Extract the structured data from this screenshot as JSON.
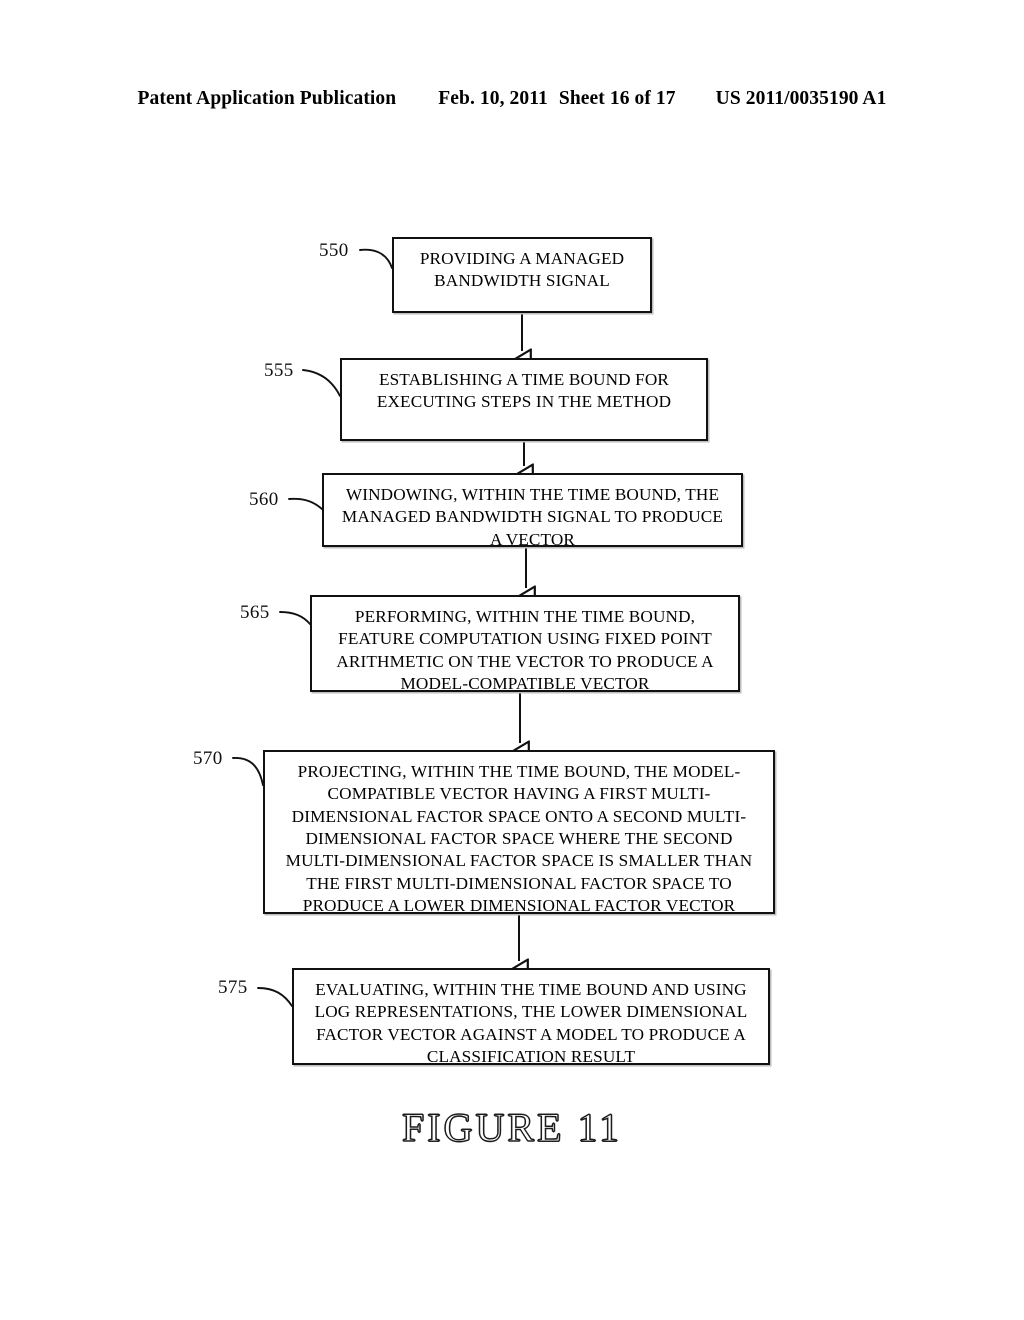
{
  "header": {
    "publication": "Patent Application Publication",
    "date": "Feb. 10, 2011",
    "sheet": "Sheet 16 of 17",
    "publication_number": "US 2011/0035190 A1"
  },
  "figure": {
    "caption": "FIGURE  11",
    "type": "flowchart",
    "orientation": "top-to-bottom",
    "arrow_style": "hollow-triangle"
  },
  "flowchart": {
    "steps": [
      {
        "ref": "550",
        "text": "PROVIDING A MANAGED\nBANDWIDTH SIGNAL"
      },
      {
        "ref": "555",
        "text": "ESTABLISHING A TIME BOUND FOR\nEXECUTING STEPS IN THE METHOD"
      },
      {
        "ref": "560",
        "text": "WINDOWING, WITHIN THE TIME BOUND, THE\nMANAGED BANDWIDTH SIGNAL TO PRODUCE\nA VECTOR"
      },
      {
        "ref": "565",
        "text": "PERFORMING, WITHIN THE TIME BOUND,\nFEATURE COMPUTATION USING FIXED POINT\nARITHMETIC ON THE VECTOR TO PRODUCE A\nMODEL-COMPATIBLE VECTOR"
      },
      {
        "ref": "570",
        "text": "PROJECTING, WITHIN THE TIME BOUND, THE MODEL-\nCOMPATIBLE VECTOR HAVING A FIRST MULTI-\nDIMENSIONAL FACTOR SPACE ONTO A SECOND MULTI-\nDIMENSIONAL FACTOR SPACE WHERE THE SECOND\nMULTI-DIMENSIONAL FACTOR SPACE IS SMALLER THAN\nTHE FIRST MULTI-DIMENSIONAL FACTOR SPACE TO\nPRODUCE A LOWER DIMENSIONAL FACTOR VECTOR"
      },
      {
        "ref": "575",
        "text": "EVALUATING, WITHIN THE TIME BOUND AND USING\nLOG REPRESENTATIONS, THE LOWER DIMENSIONAL\nFACTOR VECTOR AGAINST A MODEL TO PRODUCE A\nCLASSIFICATION RESULT"
      }
    ]
  },
  "colors": {
    "ink": "#111111",
    "page": "#ffffff",
    "box_shadow": "#bdbdbd"
  }
}
